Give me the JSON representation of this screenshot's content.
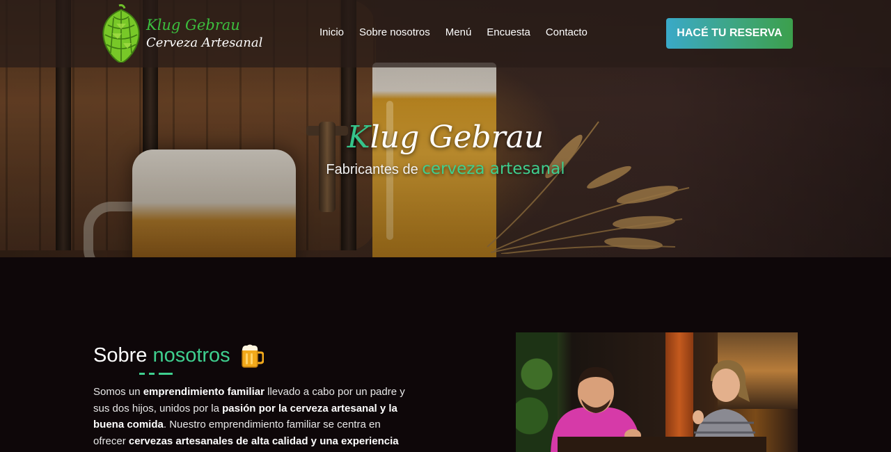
{
  "header": {
    "logo": {
      "name": "Klug Gebrau",
      "tagline": "Cerveza Artesanal"
    },
    "nav": [
      "Inicio",
      "Sobre nosotros",
      "Menú",
      "Encuesta",
      "Contacto"
    ],
    "cta_label": "HACÉ TU RESERVA"
  },
  "hero": {
    "title_first": "K",
    "title_rest": "lug Gebrau",
    "subtitle_plain": "Fabricantes de ",
    "subtitle_accent": "cerveza artesanal"
  },
  "about": {
    "title_plain": "Sobre ",
    "title_accent": "nosotros",
    "paragraph": [
      {
        "t": "Somos un ",
        "b": false
      },
      {
        "t": "emprendimiento familiar",
        "b": true
      },
      {
        "t": " llevado a cabo por un padre y sus dos hijos, unidos por la ",
        "b": false
      },
      {
        "t": "pasión por la cerveza artesanal y la buena comida",
        "b": true
      },
      {
        "t": ". Nuestro emprendimiento familiar se centra en ofrecer ",
        "b": false
      },
      {
        "t": "cervezas artesanales de alta calidad y una experiencia",
        "b": true
      }
    ]
  },
  "colors": {
    "accent": "#3fcf8f",
    "logo_green": "#3cbf3e",
    "background": "#0e0709",
    "cta_start": "#3aa9c8",
    "cta_end": "#3c9f4c"
  },
  "icons": [
    "hop-cone-icon",
    "beer-mug-icon"
  ]
}
